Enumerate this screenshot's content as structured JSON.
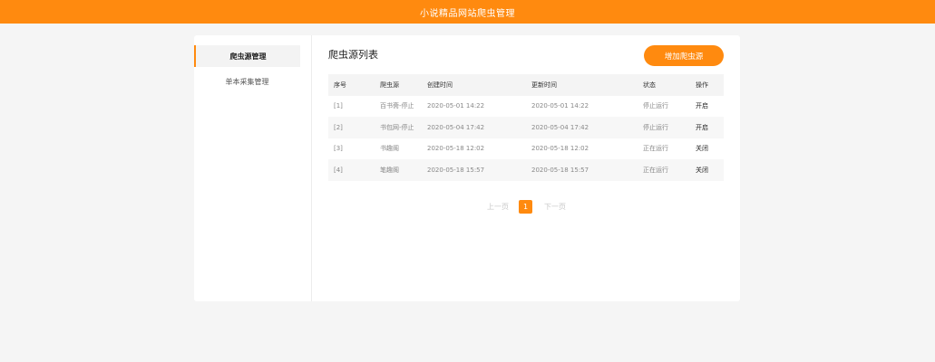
{
  "header": {
    "title": "小说精品网站爬虫管理"
  },
  "sidebar": {
    "items": [
      {
        "label": "爬虫源管理",
        "active": true
      },
      {
        "label": "单本采集管理",
        "active": false
      }
    ]
  },
  "main": {
    "title": "爬虫源列表",
    "add_button": "增加爬虫源"
  },
  "table": {
    "headers": [
      "序号",
      "爬虫源",
      "创建时间",
      "更新时间",
      "状态",
      "操作"
    ],
    "rows": [
      [
        "[1]",
        "百书斋-停止",
        "2020-05-01 14:22",
        "2020-05-01 14:22",
        "停止运行",
        "开启"
      ],
      [
        "[2]",
        "书包网-停止",
        "2020-05-04 17:42",
        "2020-05-04 17:42",
        "停止运行",
        "开启"
      ],
      [
        "[3]",
        "书趣阁",
        "2020-05-18 12:02",
        "2020-05-18 12:02",
        "正在运行",
        "关闭"
      ],
      [
        "[4]",
        "笔趣阁",
        "2020-05-18 15:57",
        "2020-05-18 15:57",
        "正在运行",
        "关闭"
      ]
    ]
  },
  "pagination": {
    "prev": "上一页",
    "current": "1",
    "next": "下一页"
  },
  "colors": {
    "accent": "#ff8a0f",
    "background": "#f5f5f5"
  }
}
